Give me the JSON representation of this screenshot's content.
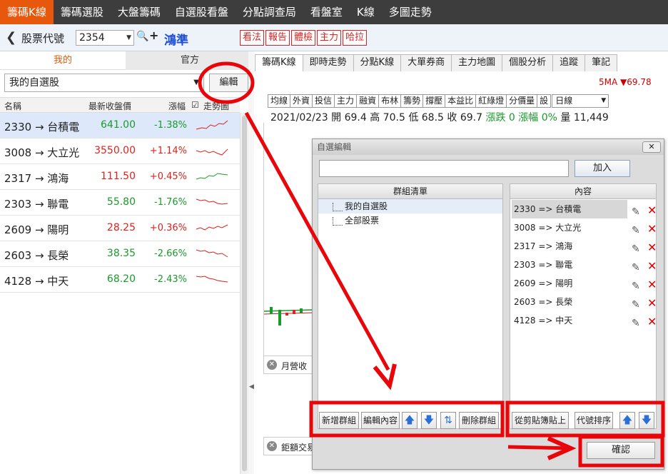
{
  "nav": [
    "籌碼K線",
    "籌碼選股",
    "大盤籌碼",
    "自選股看盤",
    "分點調查局",
    "看盤室",
    "K線",
    "多圖走勢"
  ],
  "stockbar": {
    "code_label": "股票代號",
    "code_value": "2354",
    "stock_name": "鴻準",
    "red_buttons": [
      "看法",
      "報告",
      "體檢",
      "主力",
      "哈拉"
    ]
  },
  "left": {
    "tab_mine": "我的",
    "tab_official": "官方",
    "group_selected": "我的自選股",
    "edit_label": "編輯",
    "headers": {
      "name": "名稱",
      "price": "最新收盤價",
      "change": "漲幅",
      "trend": "走勢圖"
    },
    "rows": [
      {
        "name": "2330 → 台積電",
        "price": "641.00",
        "change": "-1.38%",
        "dir": "dn"
      },
      {
        "name": "3008 → 大立光",
        "price": "3550.00",
        "change": "+1.14%",
        "dir": "up"
      },
      {
        "name": "2317 → 鴻海",
        "price": "111.50",
        "change": "+0.45%",
        "dir": "up"
      },
      {
        "name": "2303 → 聯電",
        "price": "55.80",
        "change": "-1.76%",
        "dir": "dn"
      },
      {
        "name": "2609 → 陽明",
        "price": "28.25",
        "change": "+0.36%",
        "dir": "up"
      },
      {
        "name": "2603 → 長榮",
        "price": "38.35",
        "change": "-2.66%",
        "dir": "dn"
      },
      {
        "name": "4128 → 中天",
        "price": "68.20",
        "change": "-2.43%",
        "dir": "dn"
      }
    ]
  },
  "right": {
    "tabs": [
      "籌碼K線",
      "即時走勢",
      "分點K線",
      "大單券商",
      "主力地圖",
      "個股分析",
      "追蹤",
      "筆記"
    ],
    "ma_label": "5MA ▼69.78",
    "tools": [
      "均線",
      "外資",
      "投信",
      "主力",
      "融資",
      "布林",
      "籌勢",
      "撐壓",
      "本益比",
      "紅綠燈",
      "分價量",
      "設"
    ],
    "period": "日線",
    "quote": {
      "date": "2021/02/23",
      "open": "開 69.4",
      "high": "高 70.5",
      "low": "低 68.5",
      "close": "收 69.7",
      "updown": "漲跌 0",
      "pct": "漲幅 0%",
      "vol": "量 11,449"
    },
    "panel1": "月營收",
    "panel2": "鉅額交易"
  },
  "dialog": {
    "title": "自選編輯",
    "add_label": "加入",
    "groups_header": "群組清單",
    "groups": [
      "我的自選股",
      "全部股票"
    ],
    "content_header": "內容",
    "items": [
      "2330 => 台積電",
      "3008 => 大立光",
      "2317 => 鴻海",
      "2303 => 聯電",
      "2609 => 陽明",
      "2603 => 長榮",
      "4128 => 中天"
    ],
    "btn_new_group": "新增群組",
    "btn_edit_content": "編輯內容",
    "btn_delete_group": "刪除群組",
    "btn_paste": "從剪貼簿貼上",
    "btn_sort": "代號排序",
    "confirm": "確認"
  },
  "colors": {
    "accent": "#e8580c",
    "up": "#e0201a",
    "down": "#1a9a2a",
    "highlight": "#e8060a"
  }
}
